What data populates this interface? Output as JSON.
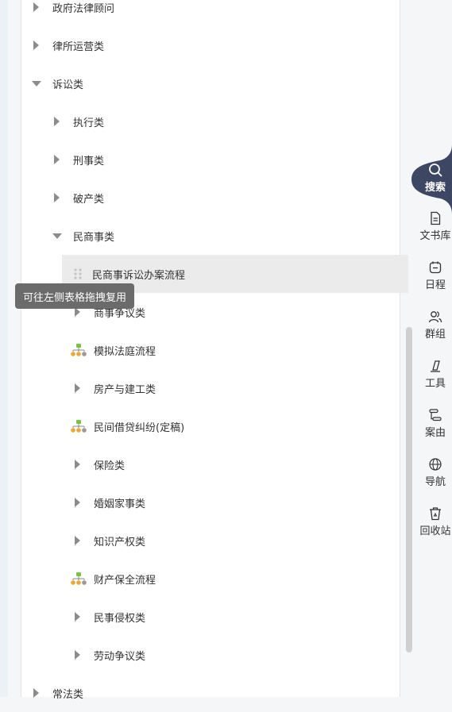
{
  "tree": {
    "items": [
      {
        "label": "政府法律顾问",
        "level": 0,
        "state": "collapsed"
      },
      {
        "label": "律所运营类",
        "level": 0,
        "state": "collapsed"
      },
      {
        "label": "诉讼类",
        "level": 0,
        "state": "expanded"
      },
      {
        "label": "执行类",
        "level": 1,
        "state": "collapsed"
      },
      {
        "label": "刑事类",
        "level": 1,
        "state": "collapsed"
      },
      {
        "label": "破产类",
        "level": 1,
        "state": "collapsed"
      },
      {
        "label": "民商事类",
        "level": 1,
        "state": "expanded"
      },
      {
        "label": "民商事诉讼办案流程",
        "level": 2,
        "state": "flow-highlighted"
      },
      {
        "label": "商事争议类",
        "level": 2,
        "state": "collapsed"
      },
      {
        "label": "模拟法庭流程",
        "level": 2,
        "state": "flow"
      },
      {
        "label": "房产与建工类",
        "level": 2,
        "state": "collapsed"
      },
      {
        "label": "民间借贷纠纷(定稿)",
        "level": 2,
        "state": "flow"
      },
      {
        "label": "保险类",
        "level": 2,
        "state": "collapsed"
      },
      {
        "label": "婚姻家事类",
        "level": 2,
        "state": "collapsed"
      },
      {
        "label": "知识产权类",
        "level": 2,
        "state": "collapsed"
      },
      {
        "label": "财产保全流程",
        "level": 2,
        "state": "flow"
      },
      {
        "label": "民事侵权类",
        "level": 2,
        "state": "collapsed"
      },
      {
        "label": "劳动争议类",
        "level": 2,
        "state": "collapsed"
      },
      {
        "label": "常法类",
        "level": 0,
        "state": "collapsed"
      }
    ]
  },
  "tooltip": {
    "text": "可往左侧表格拖拽复用"
  },
  "rail": {
    "search": "搜索",
    "library": "文书库",
    "schedule": "日程",
    "groups": "群组",
    "tools": "工具",
    "cause": "案由",
    "nav": "导航",
    "recycle": "回收站"
  },
  "colors": {
    "accent": "#3d4763",
    "highlight": "#ebebeb",
    "tooltip": "#6b6b6b",
    "flow_green": "#7cc243",
    "flow_orange": "#f0a53a"
  }
}
